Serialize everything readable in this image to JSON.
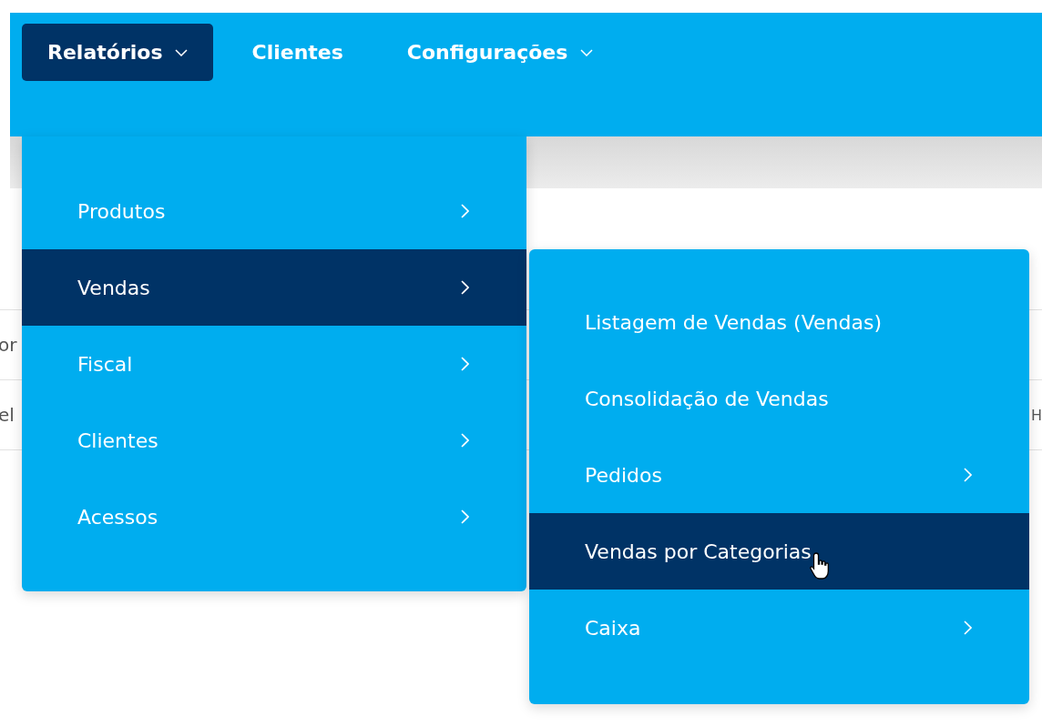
{
  "nav": [
    {
      "label": "Relatórios",
      "dropdown": true,
      "selected": true
    },
    {
      "label": "Clientes",
      "dropdown": false,
      "selected": false
    },
    {
      "label": "Configurações",
      "dropdown": true,
      "selected": false
    }
  ],
  "menu": {
    "items": [
      {
        "label": "Produtos",
        "has_submenu": true,
        "selected": false
      },
      {
        "label": "Vendas",
        "has_submenu": true,
        "selected": true
      },
      {
        "label": "Fiscal",
        "has_submenu": true,
        "selected": false
      },
      {
        "label": "Clientes",
        "has_submenu": true,
        "selected": false
      },
      {
        "label": "Acessos",
        "has_submenu": true,
        "selected": false
      }
    ]
  },
  "submenu": {
    "items": [
      {
        "label": "Listagem de Vendas (Vendas)",
        "has_submenu": false,
        "selected": false
      },
      {
        "label": "Consolidação de Vendas",
        "has_submenu": false,
        "selected": false
      },
      {
        "label": "Pedidos",
        "has_submenu": true,
        "selected": false
      },
      {
        "label": "Vendas por Categorias",
        "has_submenu": false,
        "selected": true
      },
      {
        "label": "Caixa",
        "has_submenu": true,
        "selected": false
      }
    ]
  },
  "background_table": {
    "rows": [
      {
        "column_1": "or"
      },
      {
        "column_1": "el",
        "column_2": "H"
      }
    ]
  }
}
